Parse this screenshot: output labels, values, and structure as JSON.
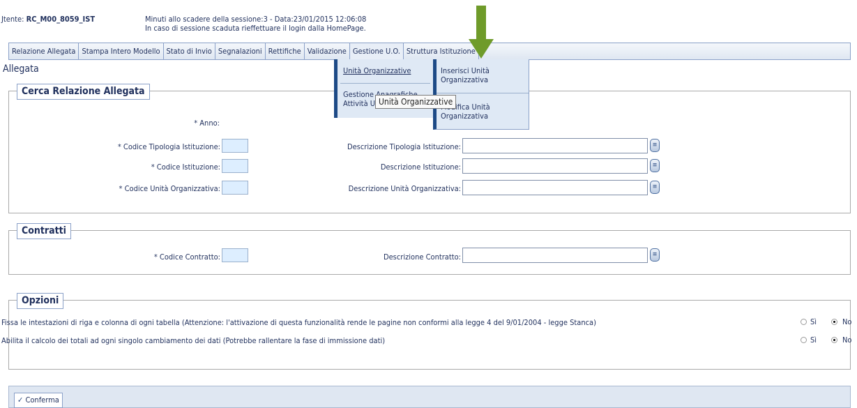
{
  "header": {
    "user_label": "Jtente:",
    "user_value": "RC_M00_8059_IST",
    "session_line": "Minuti allo scadere della sessione:3 - Data:23/01/2015 12:06:08",
    "session_note": "In caso di sessione scaduta rieffettuare il login dalla HomePage."
  },
  "menu": [
    "Relazione Allegata",
    "Stampa Intero Modello",
    "Stato di Invio",
    "Segnalazioni",
    "Rettifiche",
    "Validazione",
    "Gestione U.O.",
    "Struttura Istituzione"
  ],
  "dropdown": {
    "level1": [
      "Unità Organizzative",
      "Gestione Anagrafiche Attività U.O."
    ],
    "level2": [
      "Inserisci Unità Organizzativa",
      "Modifica Unità Organizzativa"
    ],
    "tooltip": "Unità Organizzative"
  },
  "page_title": "Allegata",
  "cerca": {
    "legend": "Cerca Relazione Allegata",
    "anno_label": "* Anno:",
    "tipologia_code_label": "* Codice Tipologia Istituzione:",
    "tipologia_desc_label": "Descrizione Tipologia Istituzione:",
    "istituzione_code_label": "* Codice Istituzione:",
    "istituzione_desc_label": "Descrizione Istituzione:",
    "uo_code_label": "* Codice Unità Organizzativa:",
    "uo_desc_label": "Descrizione Unità Organizzativa:"
  },
  "contratti": {
    "legend": "Contratti",
    "code_label": "* Codice Contratto:",
    "desc_label": "Descrizione Contratto:"
  },
  "opzioni": {
    "legend": "Opzioni",
    "option1": "Fissa le intestazioni di riga e colonna di ogni tabella (Attenzione: l'attivazione di questa funzionalità rende le pagine non conformi alla legge 4 del 9/01/2004 - legge Stanca)",
    "option2": "Abilita il calcolo dei totali ad ogni singolo cambiamento dei dati (Potrebbe rallentare la fase di immissione dati)",
    "yes_label": "Sì",
    "no_label": "No",
    "option1_selected": "No",
    "option2_selected": "No"
  },
  "footer": {
    "confirm_label": "Conferma"
  },
  "colors": {
    "annotation_arrow": "#6f9b2a",
    "menu_border": "#8aa0c8",
    "text": "#1f2f5c"
  }
}
